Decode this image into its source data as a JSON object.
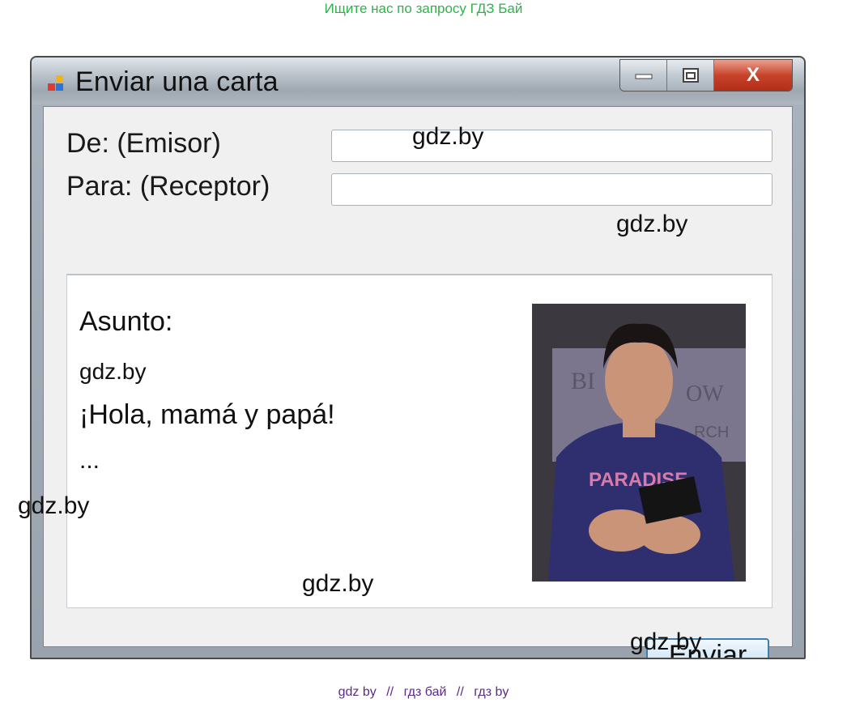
{
  "page": {
    "top_note": "Ищите нас по запросу ГДЗ Бай",
    "bottom_note": [
      "gdz by",
      "гдз бай",
      "гдз by"
    ],
    "bottom_separator": "//"
  },
  "window": {
    "title": "Enviar una carta",
    "minimize_glyph": "▬",
    "maximize_glyph": "▭",
    "close_glyph": "X"
  },
  "form": {
    "from_label": "De: (Emisor)",
    "from_value": "",
    "to_label": "Para: (Receptor)",
    "to_value": ""
  },
  "message": {
    "subject_label": "Asunto:",
    "line1": "gdz.by",
    "line2": "¡Hola, mamá y papá!",
    "line3": "..."
  },
  "photo": {
    "semantic": "portrait-photo",
    "shirt_text": "PARADISE"
  },
  "send_button": "Enviar",
  "watermarks": {
    "w1": "gdz.by",
    "w2": "gdz.by",
    "w3": "gdz.by",
    "w4": "gdz.by",
    "w5": "gdz.by"
  },
  "colors": {
    "top_note": "#2fb14a",
    "bottom_note": "#5a2a88",
    "close_button": "#c8432a",
    "send_border": "#3c7fb1"
  }
}
